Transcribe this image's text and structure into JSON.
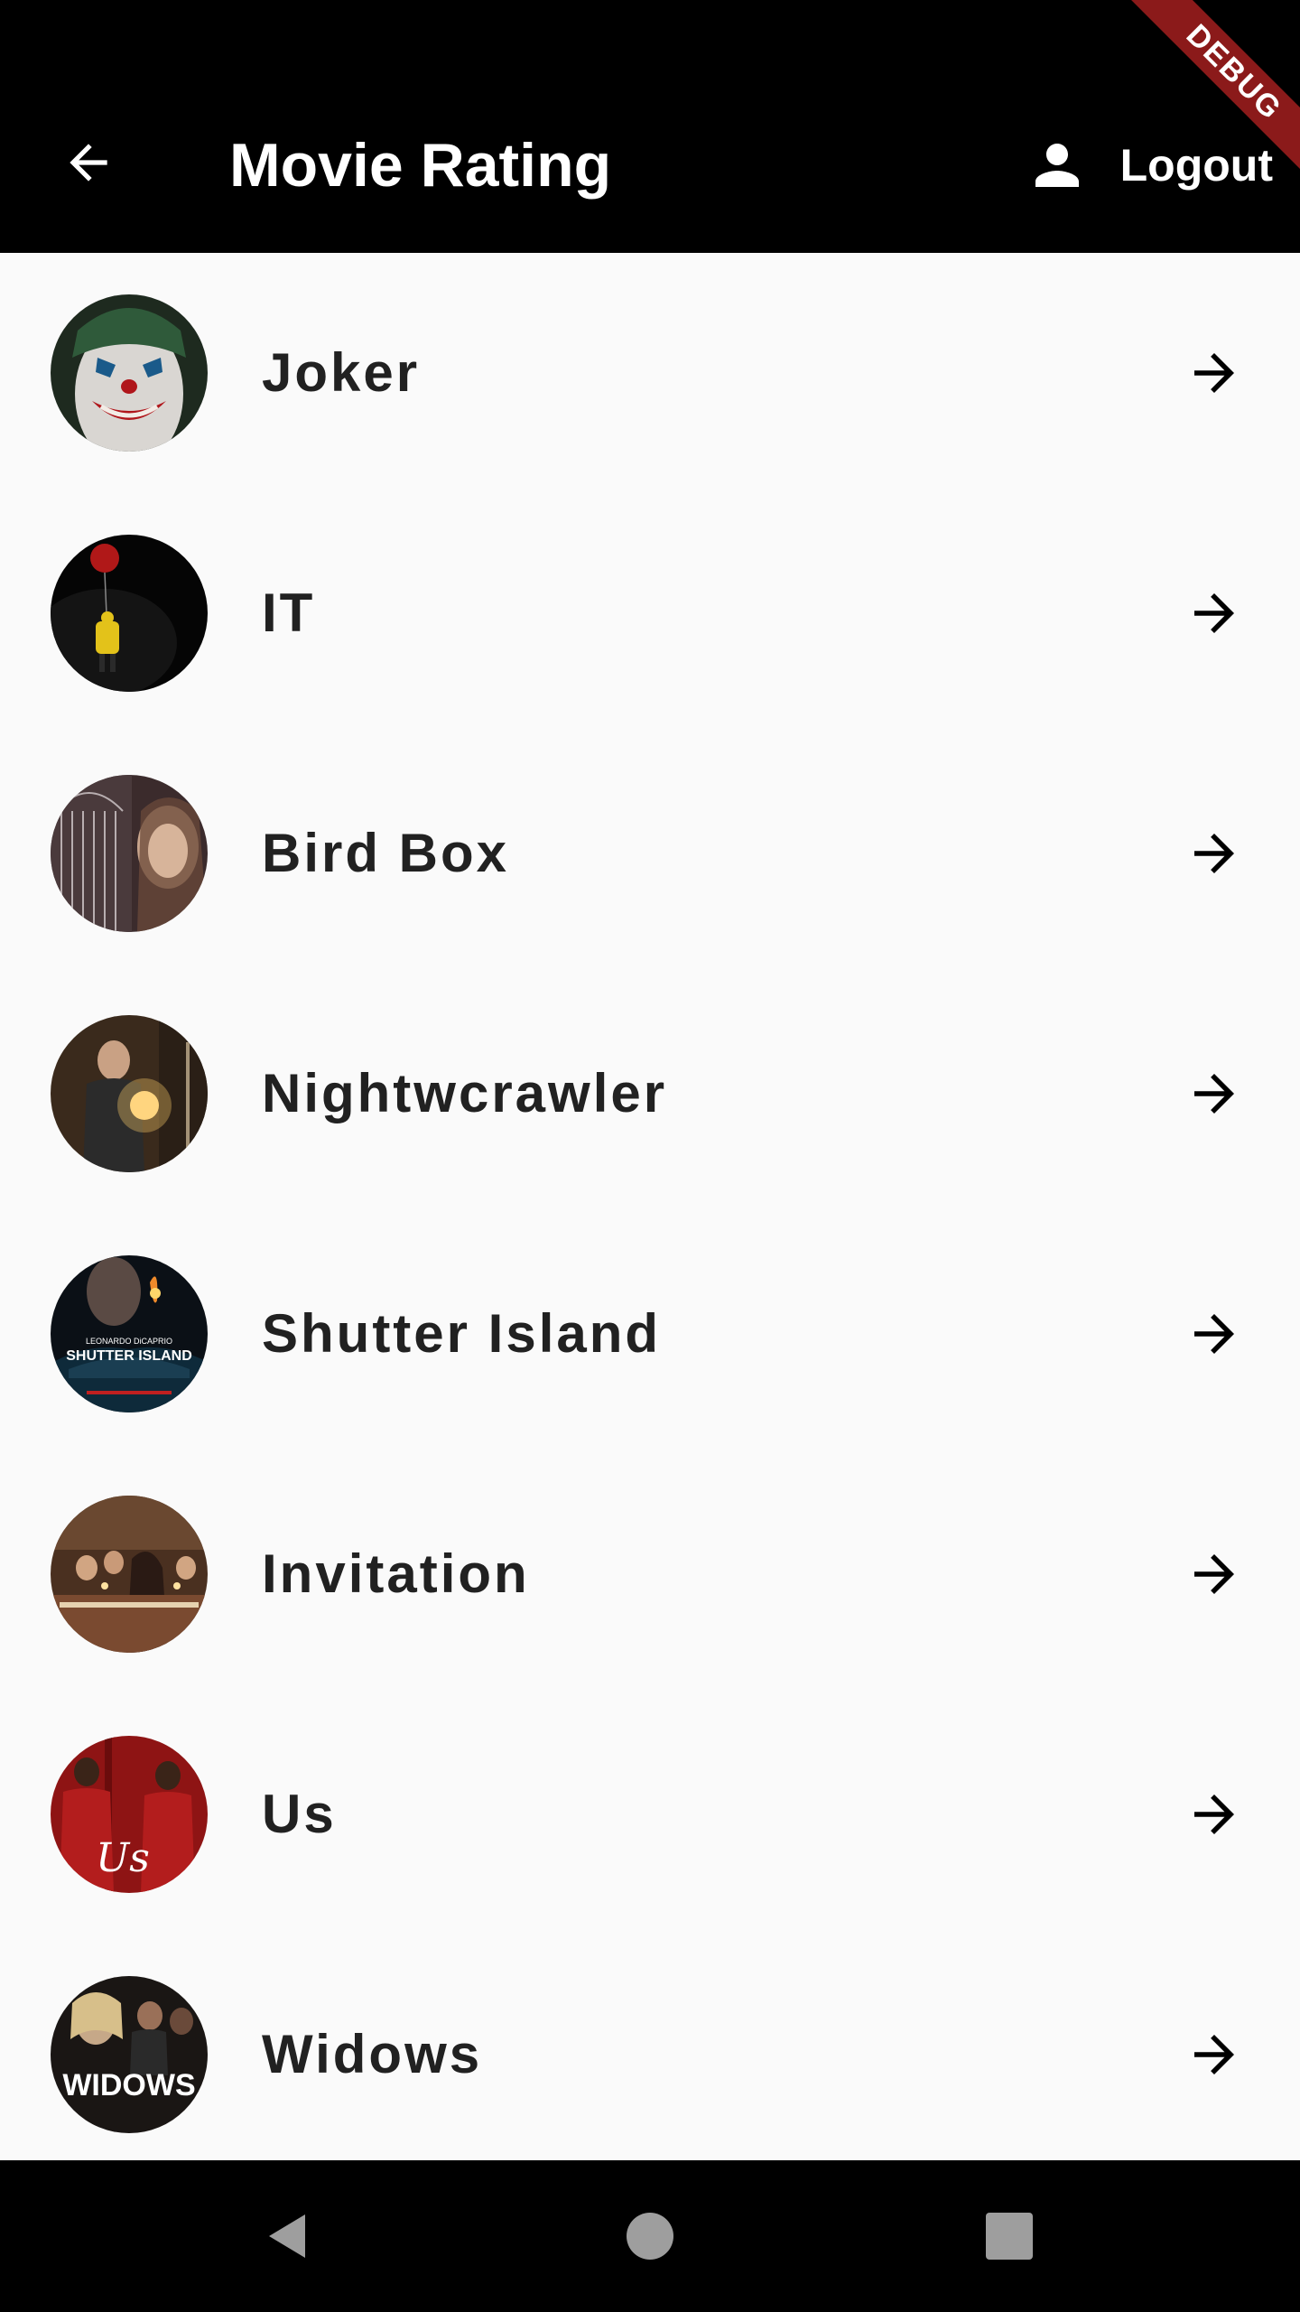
{
  "app_bar": {
    "title": "Movie Rating",
    "back_icon": "arrow-back-icon",
    "logout_label": "Logout",
    "logout_icon": "person-icon",
    "debug_banner": "DEBUG"
  },
  "movies": [
    {
      "title": "Joker",
      "poster": "joker-poster-thumbnail"
    },
    {
      "title": "IT",
      "poster": "it-poster-thumbnail"
    },
    {
      "title": "Bird Box",
      "poster": "bird-box-poster-thumbnail"
    },
    {
      "title": "Nightwcrawler",
      "poster": "nightcrawler-poster-thumbnail"
    },
    {
      "title": "Shutter Island",
      "poster": "shutter-island-poster-thumbnail",
      "poster_text": [
        "LEONARDO DiCAPRIO",
        "SHUTTER ISLAND"
      ]
    },
    {
      "title": "Invitation",
      "poster": "invitation-poster-thumbnail"
    },
    {
      "title": "Us",
      "poster": "us-poster-thumbnail",
      "poster_text": [
        "Us"
      ]
    },
    {
      "title": "Widows",
      "poster": "widows-poster-thumbnail",
      "poster_text": [
        "WIDOWS"
      ]
    }
  ],
  "nav_bar": {
    "back": "nav-back-icon",
    "home": "nav-home-icon",
    "recents": "nav-recents-icon"
  },
  "colors": {
    "app_bar_bg": "#000000",
    "list_bg": "#fafafa",
    "title_text": "#212121",
    "debug_banner": "#8b1a1a"
  }
}
